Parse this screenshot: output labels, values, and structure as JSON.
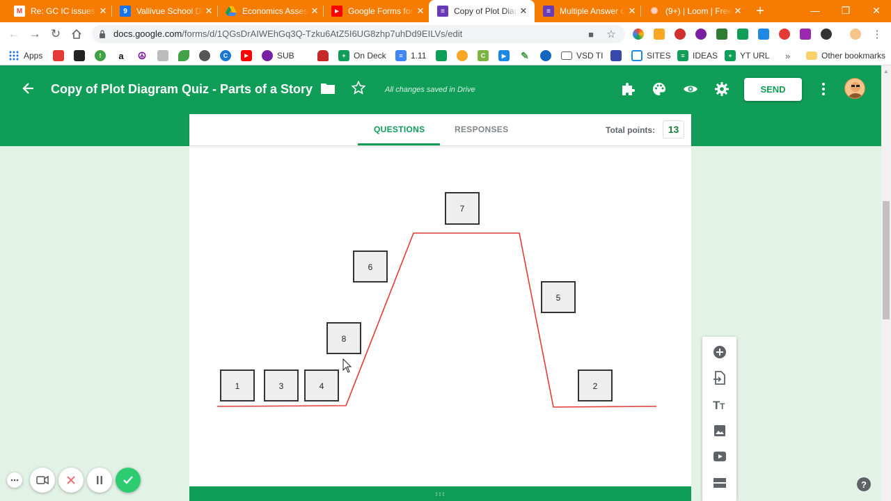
{
  "browser": {
    "tabs": [
      {
        "title": "Re: GC IC issues -",
        "favicon_color": "#ea4335",
        "favicon_glyph": "M"
      },
      {
        "title": "Vallivue School Di",
        "favicon_color": "#1a73e8",
        "favicon_glyph": "9"
      },
      {
        "title": "Economics Assess",
        "favicon_color": "#fbbc04",
        "favicon_glyph": ""
      },
      {
        "title": "Google Forms for",
        "favicon_color": "#ff0000",
        "favicon_glyph": "▶"
      },
      {
        "title": "Copy of Plot Diag",
        "favicon_color": "#673ab7",
        "favicon_glyph": "≡"
      },
      {
        "title": "Multiple Answer c",
        "favicon_color": "#673ab7",
        "favicon_glyph": "≡"
      },
      {
        "title": "(9+) | Loom | Free",
        "favicon_color": "#ff5a36",
        "favicon_glyph": "✺"
      }
    ],
    "active_tab_index": 4,
    "url_host": "docs.google.com",
    "url_path": "/forms/d/1QGsDrAIWEhGq3Q-Tzku6AtZ5I6UG8zhp7uhDd9EILVs/edit",
    "bookmarks": [
      {
        "label": "Apps",
        "icon": "apps-grid-icon",
        "color": "#5f6368"
      },
      {
        "label": "",
        "icon": "espn-icon",
        "color": "#e53935"
      },
      {
        "label": "",
        "icon": "bb-icon",
        "color": "#222222"
      },
      {
        "label": "",
        "icon": "exclamation-icon",
        "color": "#43a047"
      },
      {
        "label": "",
        "icon": "amazon-icon",
        "color": "#111111"
      },
      {
        "label": "",
        "icon": "peace-icon",
        "color": "#7b1fa2"
      },
      {
        "label": "",
        "icon": "bike-icon",
        "color": "#888888"
      },
      {
        "label": "",
        "icon": "leaf-icon",
        "color": "#43a047"
      },
      {
        "label": "",
        "icon": "globe-icon",
        "color": "#555555"
      },
      {
        "label": "",
        "icon": "c-circle-icon",
        "color": "#1976d2"
      },
      {
        "label": "",
        "icon": "youtube-icon",
        "color": "#ff0000"
      },
      {
        "label": "SUB",
        "icon": "sub-icon",
        "color": "#7b1fa2"
      },
      {
        "label": "",
        "icon": "car-icon",
        "color": "#c62828"
      },
      {
        "label": "On Deck",
        "icon": "sheets-plus-icon",
        "color": "#0f9d58"
      },
      {
        "label": "1.11",
        "icon": "docs-icon",
        "color": "#4285f4"
      },
      {
        "label": "",
        "icon": "classroom-icon",
        "color": "#0f9d58"
      },
      {
        "label": "",
        "icon": "emoji-icon",
        "color": "#f9a825"
      },
      {
        "label": "",
        "icon": "c-green-icon",
        "color": "#7cb342"
      },
      {
        "label": "",
        "icon": "play-icon",
        "color": "#1e88e5"
      },
      {
        "label": "",
        "icon": "pencil-icon",
        "color": "#43a047"
      },
      {
        "label": "",
        "icon": "earth-icon",
        "color": "#1565c0"
      },
      {
        "label": "VSD TI",
        "icon": "card-icon",
        "color": "#555555"
      },
      {
        "label": "",
        "icon": "calendar-icon",
        "color": "#3949ab"
      },
      {
        "label": "SITES",
        "icon": "sites-icon",
        "color": "#1e88e5"
      },
      {
        "label": "IDEAS",
        "icon": "sheets-icon",
        "color": "#0f9d58"
      },
      {
        "label": "YT URL",
        "icon": "sheets-plus-icon",
        "color": "#0f9d58"
      }
    ],
    "bookmarks_more": "»",
    "other_bookmarks": "Other bookmarks"
  },
  "header": {
    "title": "Copy of Plot Diagram Quiz - Parts of a Story",
    "saved_status": "All changes saved in Drive",
    "send_label": "SEND",
    "accent_color": "#0f9d58"
  },
  "card": {
    "tabs": [
      {
        "label": "QUESTIONS",
        "active": true
      },
      {
        "label": "RESPONSES",
        "active": false
      }
    ],
    "total_points_label": "Total points:",
    "total_points_value": "13"
  },
  "plot_diagram": {
    "line_color": "#e53935",
    "boxes": [
      "1",
      "3",
      "4",
      "8",
      "6",
      "7",
      "5",
      "2"
    ]
  },
  "side_tools": [
    "add-question-icon",
    "import-questions-icon",
    "add-title-icon",
    "add-image-icon",
    "add-video-icon",
    "add-section-icon"
  ],
  "help_label": "?"
}
